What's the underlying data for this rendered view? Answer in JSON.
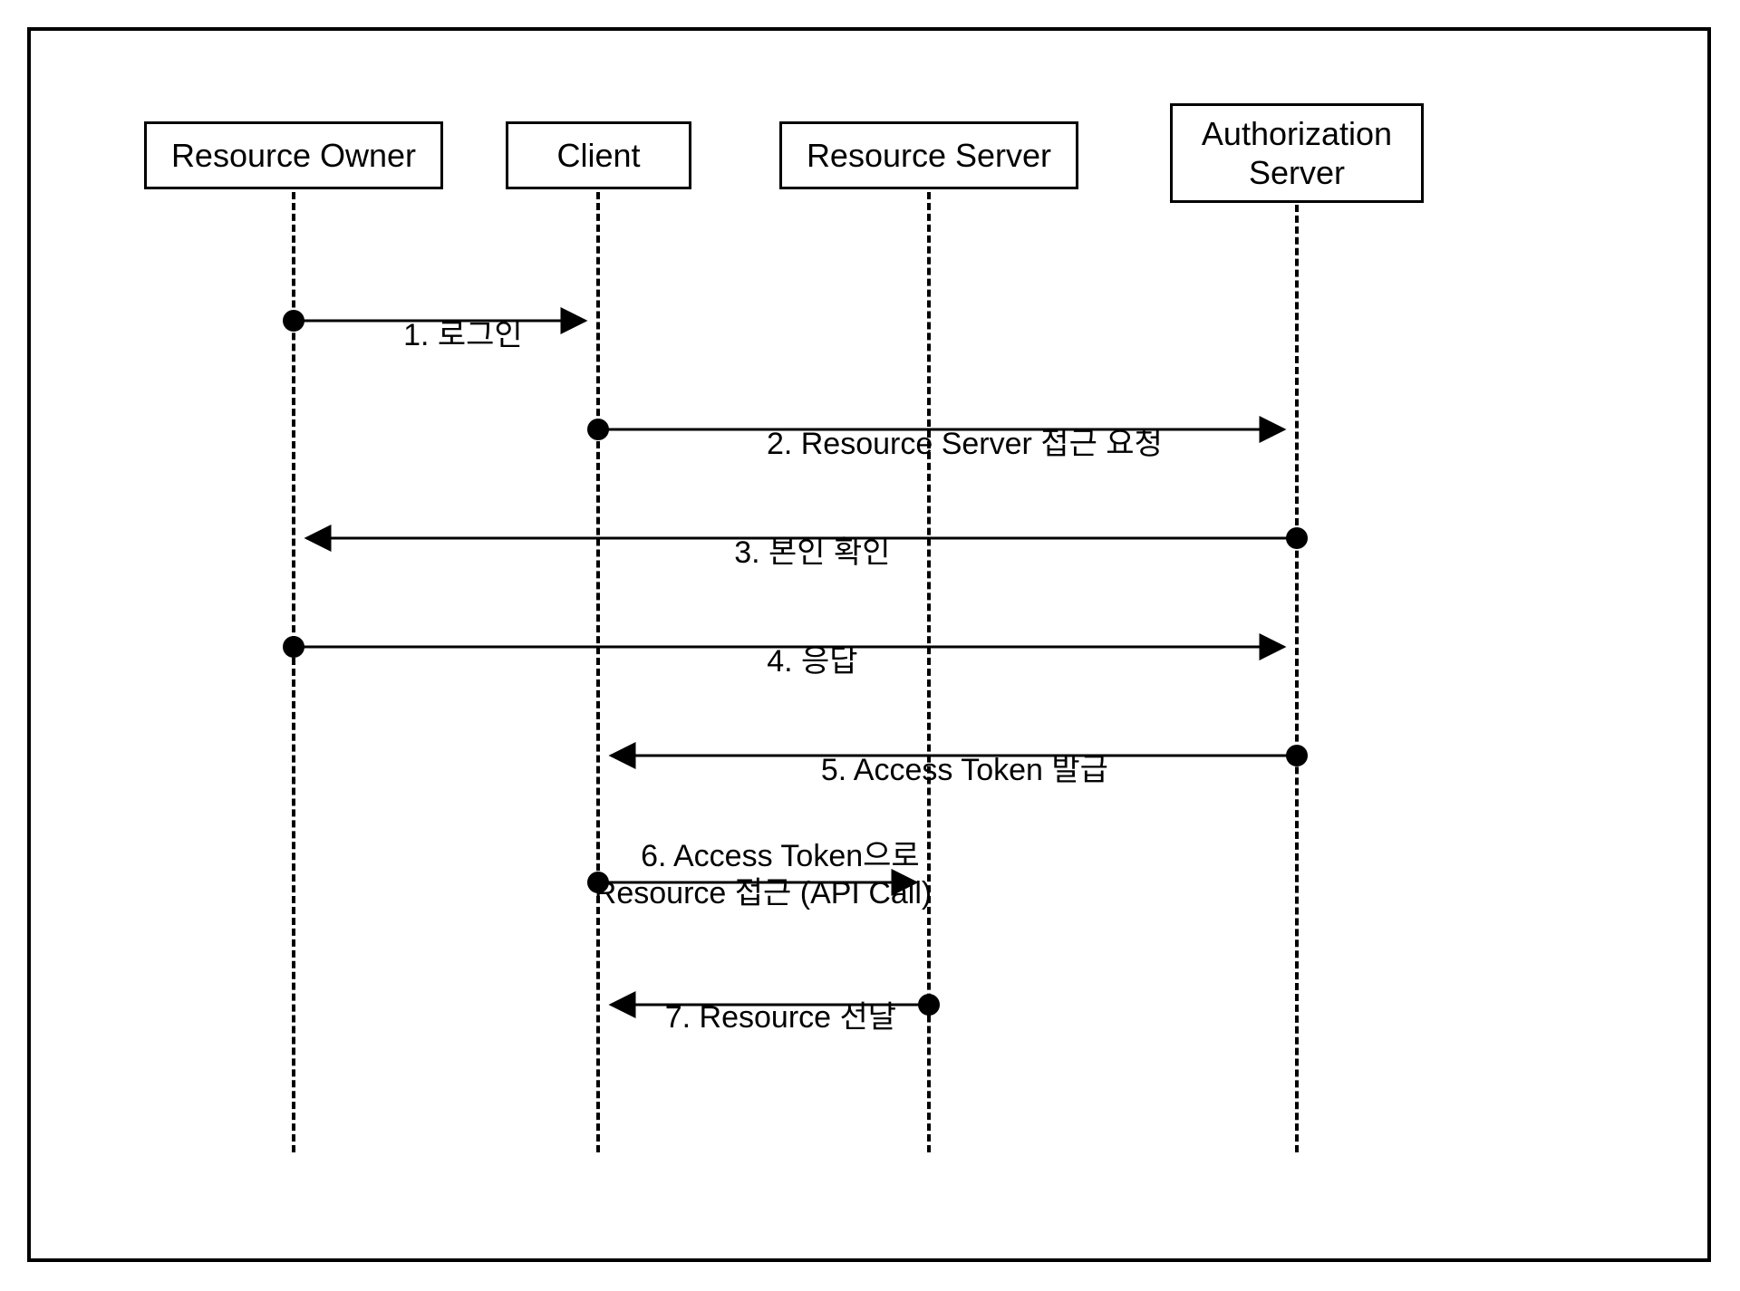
{
  "participants": {
    "resource_owner": "Resource Owner",
    "client": "Client",
    "resource_server": "Resource Server",
    "authorization_server": "Authorization\nServer"
  },
  "messages": {
    "m1": "1. 로그인",
    "m2": "2. Resource Server 접근 요청",
    "m3": "3. 본인 확인",
    "m4": "4. 응답",
    "m5": "5. Access Token 발급",
    "m6": "6. Access Token으로\nResource 접근 (API Call)",
    "m7": "7. Resource 전달"
  },
  "chart_data": {
    "type": "sequence-diagram",
    "participants": [
      "Resource Owner",
      "Client",
      "Resource Server",
      "Authorization Server"
    ],
    "steps": [
      {
        "n": 1,
        "from": "Resource Owner",
        "to": "Client",
        "label": "로그인"
      },
      {
        "n": 2,
        "from": "Client",
        "to": "Authorization Server",
        "label": "Resource Server 접근 요청"
      },
      {
        "n": 3,
        "from": "Authorization Server",
        "to": "Resource Owner",
        "label": "본인 확인"
      },
      {
        "n": 4,
        "from": "Resource Owner",
        "to": "Authorization Server",
        "label": "응답"
      },
      {
        "n": 5,
        "from": "Authorization Server",
        "to": "Client",
        "label": "Access Token 발급"
      },
      {
        "n": 6,
        "from": "Client",
        "to": "Resource Server",
        "label": "Access Token으로 Resource 접근 (API Call)"
      },
      {
        "n": 7,
        "from": "Resource Server",
        "to": "Client",
        "label": "Resource 전달"
      }
    ]
  }
}
